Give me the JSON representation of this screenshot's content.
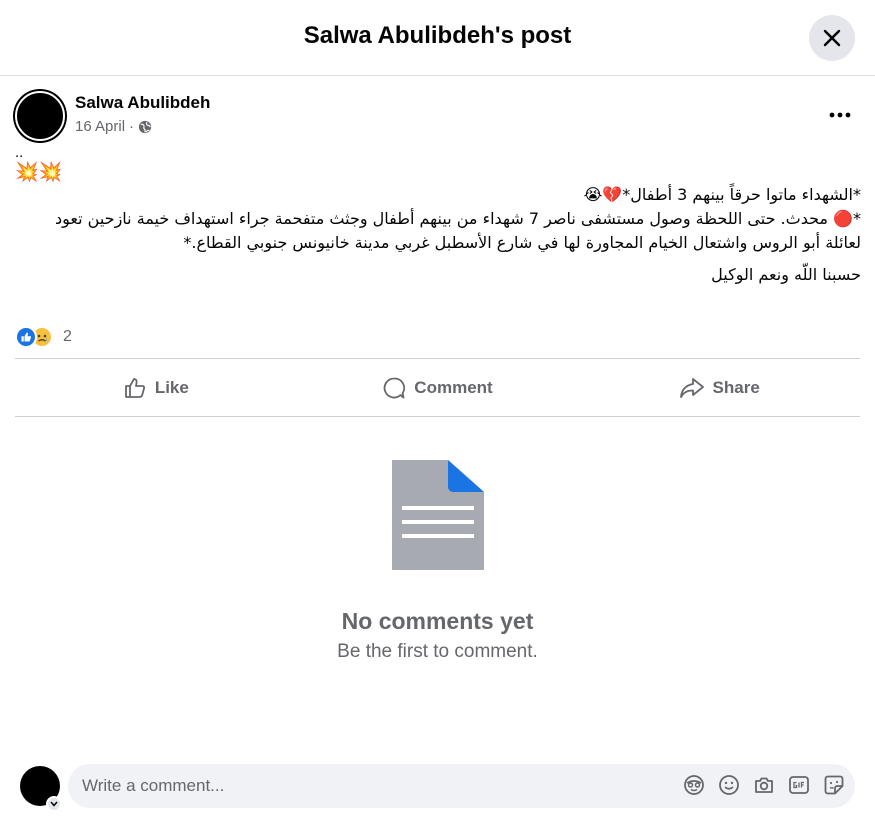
{
  "dialog": {
    "title": "Salwa Abulibdeh's post"
  },
  "post": {
    "author": "Salwa Abulibdeh",
    "date": "16 April",
    "separator": "·",
    "dots": "..",
    "emoji_line": "💥💥",
    "paragraphs": [
      "*الشهداء ماتوا حرقاً بينهم 3 أطفال*💔😭",
      "*🔴 محدث. حتى اللحظة وصول مستشفى ناصر 7 شهداء من بينهم أطفال وجثث متفحمة جراء استهداف خيمة نازحين تعود لعائلة أبو الروس واشتعال الخيام المجاورة لها في شارع الأسطبل غربي مدينة خانيونس جنوبي القطاع.*",
      "حسبنا اللّه ونعم الوكيل"
    ],
    "reaction_count": "2"
  },
  "actions": {
    "like": "Like",
    "comment": "Comment",
    "share": "Share"
  },
  "empty_state": {
    "title": "No comments yet",
    "subtitle": "Be the first to comment."
  },
  "composer": {
    "placeholder": "Write a comment..."
  },
  "colors": {
    "accent": "#1b74e4",
    "muted_text": "#65676b",
    "divider": "#ced0d4",
    "input_bg": "#f0f2f5"
  },
  "icons": [
    "close-icon",
    "globe-icon",
    "more-icon",
    "like-reaction-icon",
    "sad-reaction-icon",
    "thumbs-up-icon",
    "comment-icon",
    "share-icon",
    "document-icon",
    "chevron-down-icon",
    "avatar-sticker-icon",
    "emoji-icon",
    "camera-icon",
    "gif-icon",
    "sticker-icon"
  ]
}
